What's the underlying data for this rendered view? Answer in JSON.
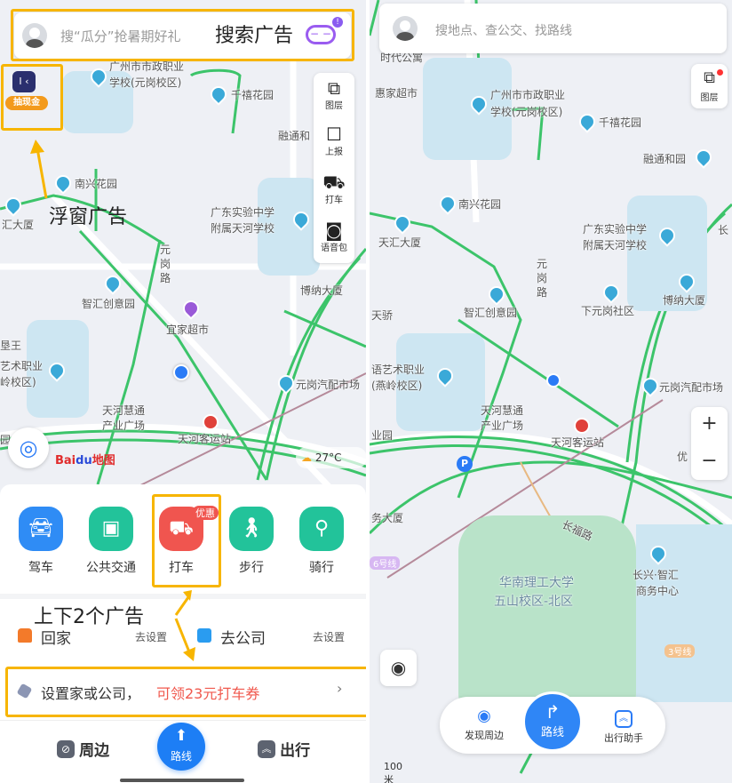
{
  "colors": {
    "accent": "#2b7bf6",
    "ad_highlight": "#f7b500",
    "road": "#3cc46a",
    "coupon_text": "#f0584d"
  },
  "left": {
    "search": {
      "placeholder": "搜“瓜分”抢暑期好礼",
      "annotation": "搜索广告",
      "ai_icon": "ai-assistant-icon",
      "badge": "!"
    },
    "float_ad": {
      "label": "抽现金",
      "annotation": "浮窗广告"
    },
    "tools": [
      {
        "label": "图层",
        "icon": "layers-icon"
      },
      {
        "label": "上报",
        "icon": "report-icon"
      },
      {
        "label": "打车",
        "icon": "taxi-icon"
      },
      {
        "label": "语音包",
        "icon": "voice-icon"
      }
    ],
    "map_labels": [
      "广州市市政职业",
      "学校(元岗校区)",
      "千禧花园",
      "融通和",
      "南兴花园",
      "汇大厦",
      "广东实验中学",
      "附属天河学校",
      "元",
      "岗",
      "路",
      "智汇创意园",
      "宜家超市",
      "博纳大厦",
      "垦王",
      "艺术职业",
      "岭校区)",
      "元岗汽配市场",
      "天河慧通",
      "产业广场",
      "天河客运站",
      "园"
    ],
    "logo": "Bai du 地图",
    "weather": "27°C",
    "modes": [
      {
        "label": "驾车",
        "icon": "car-icon"
      },
      {
        "label": "公共交通",
        "icon": "bus-icon"
      },
      {
        "label": "打车",
        "icon": "taxi-icon",
        "badge": "优惠"
      },
      {
        "label": "步行",
        "icon": "walk-icon"
      },
      {
        "label": "骑行",
        "icon": "bike-icon"
      }
    ],
    "ads_annotation": "上下2个广告",
    "home": {
      "label": "回家",
      "action": "去设置"
    },
    "work": {
      "label": "去公司",
      "action": "去设置"
    },
    "coupon": {
      "text": "设置家或公司，",
      "highlight": "可领23元打车券",
      "chevron": "›"
    },
    "nav": {
      "nearby": "周边",
      "route": "路线",
      "travel": "出行"
    }
  },
  "right": {
    "search": {
      "placeholder": "搜地点、查公交、找路线"
    },
    "layers": "图层",
    "map_labels": [
      "时代公寓",
      "惠家超市",
      "广州市市政职业",
      "学校(元岗校区)",
      "千禧花园",
      "融通和园",
      "南兴花园",
      "天汇大厦",
      "广东实验中学",
      "附属天河学校",
      "元",
      "岗",
      "路",
      "智汇创意园",
      "下元岗社区",
      "博纳大厦",
      "天骄",
      "语艺术职业",
      "(燕岭校区)",
      "元岗汽配市场",
      "天河慧通",
      "产业广场",
      "天河客运站",
      "业园",
      "务大厦",
      "长福路",
      "华南理工大学",
      "五山校区-北区",
      "长兴·智汇",
      "商务中心",
      "优",
      "长"
    ],
    "line_badges": [
      "6号线",
      "3号线"
    ],
    "zoom": {
      "in": "+",
      "out": "−"
    },
    "bottom": {
      "discover": "发现周边",
      "route": "路线",
      "assistant": "出行助手"
    },
    "scale": "100米"
  }
}
